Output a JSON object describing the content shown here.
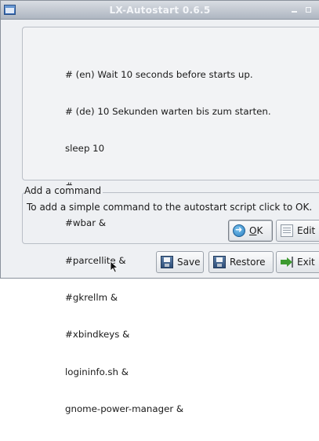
{
  "window": {
    "title": "LX-Autostart 0.6.5"
  },
  "script": {
    "lines": [
      "# (en) Wait 10 seconds before starts up.",
      "# (de) 10 Sekunden warten bis zum starten.",
      "sleep 10",
      "#",
      "#wbar &",
      "#parcellite &",
      "#gkrellm &",
      "#xbindkeys &",
      "logininfo.sh &",
      "gnome-power-manager &"
    ]
  },
  "add_command": {
    "title": "Add a command",
    "description": "To add a simple command to the autostart script click to OK.",
    "ok_label_mnemonic": "O",
    "ok_label_rest": "K",
    "edit_label": "Edit"
  },
  "footer": {
    "save_label": "Save",
    "restore_label": "Restore",
    "exit_label": "Exit"
  },
  "icons": {
    "window": "window-icon",
    "ok": "ok-arrow-icon",
    "edit": "edit-document-icon",
    "save": "floppy-disk-icon",
    "restore": "floppy-disk-icon",
    "exit": "exit-arrow-icon",
    "cursor": "mouse-pointer-icon"
  }
}
